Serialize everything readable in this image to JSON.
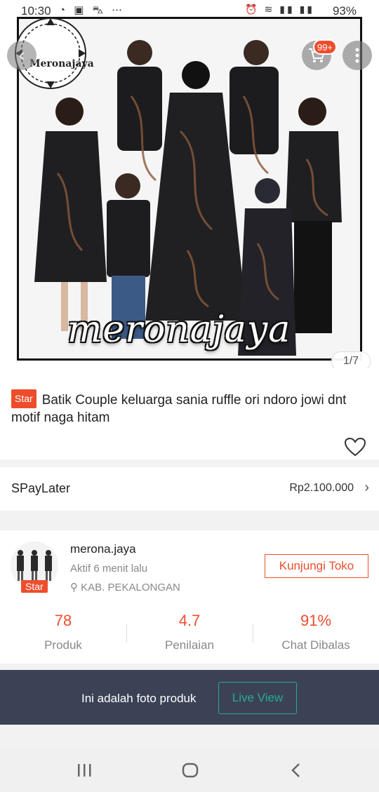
{
  "status_bar": {
    "time": "10:30",
    "battery": "93%"
  },
  "product": {
    "brand_seal_text": "Meronajaya",
    "watermark": "meronajaya",
    "image_counter": "1/7",
    "cart_badge": "99+",
    "badge": "Star",
    "title": "Batik Couple keluarga sania ruffle ori ndoro jowi dnt motif naga hitam"
  },
  "spaylater": {
    "label": "SPayLater",
    "price": "Rp2.100.000"
  },
  "shop": {
    "name": "merona.jaya",
    "active": "Aktif 6 menit lalu",
    "location": "KAB. PEKALONGAN",
    "badge": "Star",
    "visit_label": "Kunjungi Toko",
    "stats": [
      {
        "value": "78",
        "label": "Produk"
      },
      {
        "value": "4.7",
        "label": "Penilaian"
      },
      {
        "value": "91%",
        "label": "Chat Dibalas"
      }
    ]
  },
  "photo_banner": {
    "text": "Ini adalah foto produk",
    "live_label": "Live View"
  },
  "colors": {
    "accent": "#ee4d2d",
    "teal": "#26aa99",
    "banner": "#3b4256"
  }
}
